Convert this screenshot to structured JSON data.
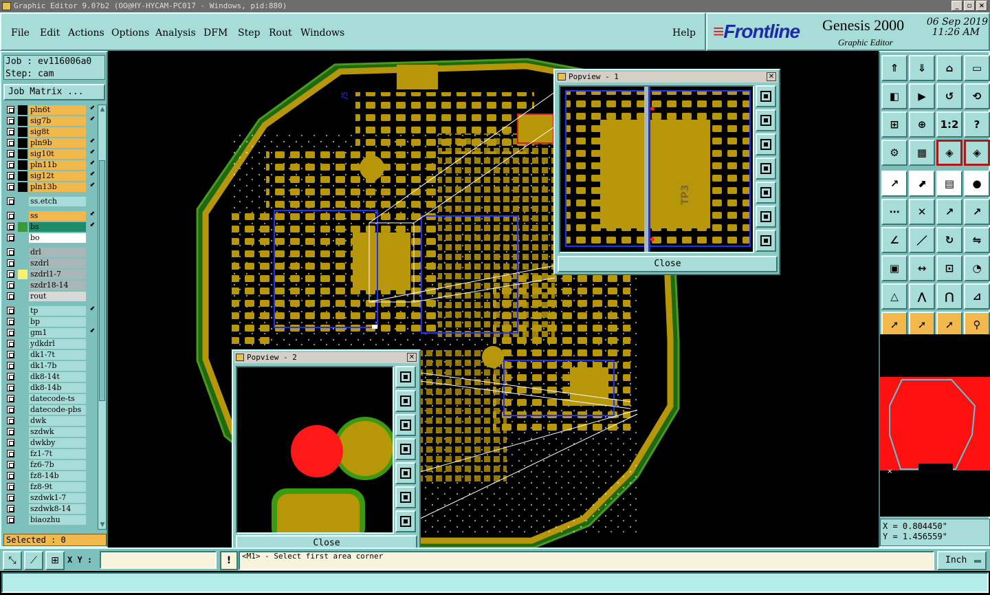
{
  "window": {
    "title": "Graphic Editor 9.0?b2 (OO@HY-HYCAM-PC017 - Windows, pid:880)",
    "buttons": [
      "_",
      "▫",
      "×"
    ]
  },
  "menu": {
    "items": [
      "File",
      "Edit",
      "Actions",
      "Options",
      "Analysis",
      "DFM",
      "Step",
      "Rout",
      "Windows"
    ],
    "help": "Help"
  },
  "brand": {
    "logo": "Frontline",
    "product": "Genesis 2000",
    "subtitle": "Graphic Editor",
    "date": "06 Sep 2019",
    "time": "11:26 AM"
  },
  "job": {
    "job_line": "Job : ev116006a0",
    "step_line": "Step: cam",
    "matrix_button": "Job Matrix ..."
  },
  "layers": [
    {
      "name": "pln6t",
      "color": "#f2b84c",
      "sw": "#000000",
      "mark": "⬋",
      "gap": false
    },
    {
      "name": "sig7b",
      "color": "#f2b84c",
      "sw": "#000000",
      "mark": "⬋",
      "gap": false
    },
    {
      "name": "sig8t",
      "color": "#f2b84c",
      "sw": "#000000",
      "mark": "",
      "gap": false
    },
    {
      "name": "pln9b",
      "color": "#f2b84c",
      "sw": "#000000",
      "mark": "⬋",
      "gap": false
    },
    {
      "name": "sig10t",
      "color": "#f2b84c",
      "sw": "#000000",
      "mark": "⬋",
      "gap": false
    },
    {
      "name": "pln11b",
      "color": "#f2b84c",
      "sw": "#000000",
      "mark": "⬋",
      "gap": false
    },
    {
      "name": "sig12t",
      "color": "#f2b84c",
      "sw": "#000000",
      "mark": "⬋",
      "gap": false
    },
    {
      "name": "pln13b",
      "color": "#f2b84c",
      "sw": "#000000",
      "mark": "⬋",
      "gap": false
    },
    {
      "name": "ss.etch",
      "color": "#a8dcd8",
      "sw": "#7ec0bc",
      "mark": "",
      "gap": true
    },
    {
      "name": "ss",
      "color": "#f2b84c",
      "sw": "#7ec0bc",
      "mark": "⬋",
      "gap": true
    },
    {
      "name": "bs",
      "color": "#1d8a6a",
      "sw": "#3a9a3a",
      "mark": "⬋",
      "gap": false
    },
    {
      "name": "bo",
      "color": "#ffffff",
      "sw": "#7ec0bc",
      "mark": "",
      "gap": false
    },
    {
      "name": "drl",
      "color": "#a8b8b8",
      "sw": "#7ec0bc",
      "mark": "",
      "gap": true
    },
    {
      "name": "szdrl",
      "color": "#a8b8b8",
      "sw": "#7ec0bc",
      "mark": "",
      "gap": false
    },
    {
      "name": "szdrl1-7",
      "color": "#a8b8b8",
      "sw": "#f8f070",
      "mark": "",
      "gap": false
    },
    {
      "name": "szdr18-14",
      "color": "#a8b8b8",
      "sw": "#7ec0bc",
      "mark": "",
      "gap": false
    },
    {
      "name": "rout",
      "color": "#d8d8d8",
      "sw": "#7ec0bc",
      "mark": "",
      "gap": false
    },
    {
      "name": "tp",
      "color": "#a8dcd8",
      "sw": "#7ec0bc",
      "mark": "⬋",
      "gap": true
    },
    {
      "name": "bp",
      "color": "#a8dcd8",
      "sw": "#7ec0bc",
      "mark": "",
      "gap": false
    },
    {
      "name": "gm1",
      "color": "#a8dcd8",
      "sw": "#7ec0bc",
      "mark": "⬋",
      "gap": false
    },
    {
      "name": "ydkdrl",
      "color": "#a8dcd8",
      "sw": "#7ec0bc",
      "mark": "",
      "gap": false
    },
    {
      "name": "dk1-7t",
      "color": "#a8dcd8",
      "sw": "#7ec0bc",
      "mark": "",
      "gap": false
    },
    {
      "name": "dk1-7b",
      "color": "#a8dcd8",
      "sw": "#7ec0bc",
      "mark": "",
      "gap": false
    },
    {
      "name": "dk8-14t",
      "color": "#a8dcd8",
      "sw": "#7ec0bc",
      "mark": "",
      "gap": false
    },
    {
      "name": "dk8-14b",
      "color": "#a8dcd8",
      "sw": "#7ec0bc",
      "mark": "",
      "gap": false
    },
    {
      "name": "datecode-ts",
      "color": "#a8dcd8",
      "sw": "#7ec0bc",
      "mark": "",
      "gap": false
    },
    {
      "name": "datecode-pbs",
      "color": "#a8dcd8",
      "sw": "#7ec0bc",
      "mark": "",
      "gap": false
    },
    {
      "name": "dwk",
      "color": "#a8dcd8",
      "sw": "#7ec0bc",
      "mark": "",
      "gap": false
    },
    {
      "name": "szdwk",
      "color": "#a8dcd8",
      "sw": "#7ec0bc",
      "mark": "",
      "gap": false
    },
    {
      "name": "dwkby",
      "color": "#a8dcd8",
      "sw": "#7ec0bc",
      "mark": "",
      "gap": false
    },
    {
      "name": "fz1-7t",
      "color": "#a8dcd8",
      "sw": "#7ec0bc",
      "mark": "",
      "gap": false
    },
    {
      "name": "fz6-7b",
      "color": "#a8dcd8",
      "sw": "#7ec0bc",
      "mark": "",
      "gap": false
    },
    {
      "name": "fz8-14b",
      "color": "#a8dcd8",
      "sw": "#7ec0bc",
      "mark": "",
      "gap": false
    },
    {
      "name": "fz8-9t",
      "color": "#a8dcd8",
      "sw": "#7ec0bc",
      "mark": "",
      "gap": false
    },
    {
      "name": "szdwk1-7",
      "color": "#a8dcd8",
      "sw": "#7ec0bc",
      "mark": "",
      "gap": false
    },
    {
      "name": "szdwk8-14",
      "color": "#a8dcd8",
      "sw": "#7ec0bc",
      "mark": "",
      "gap": false
    },
    {
      "name": "biaozhu",
      "color": "#a8dcd8",
      "sw": "#7ec0bc",
      "mark": "",
      "gap": false
    }
  ],
  "selected": "Selected : 0",
  "popview1": {
    "title": "Popview - 1",
    "close": "Close",
    "label": "TP3"
  },
  "popview2": {
    "title": "Popview - 2",
    "close": "Close"
  },
  "canvas_labels": {
    "j5": "J5"
  },
  "toolbox": {
    "icons": [
      "step-up-icon",
      "step-down-icon",
      "home-icon",
      "window-icon",
      "pan-left-icon",
      "pan-right-icon",
      "undo-icon",
      "redraw-icon",
      "zoom-fit-icon",
      "zoom-center-icon",
      "zoom-1-2-icon",
      "help-icon",
      "settings-icon",
      "grid-icon",
      "net-select-icon",
      "net-highlight-icon",
      "pad-arrow-icon",
      "line-color-icon",
      "ruler-icon",
      "dot-icon",
      "connect-icon",
      "cross-icon",
      "arrow-red-icon",
      "arrow-blue-icon",
      "angle-icon",
      "slash-icon",
      "rotate-icon",
      "flip-icon",
      "layer-pad-icon",
      "move-icon",
      "frame-icon",
      "overlay-icon",
      "triangle-a-icon",
      "triangle-b-icon",
      "triangle-c-icon",
      "triangle-d-icon",
      "pointer-icon",
      "pointer-box-icon",
      "pointer-select-icon",
      "net-pointer-icon"
    ],
    "glyphs": [
      "⇑",
      "⇓",
      "⌂",
      "▭",
      "◧",
      "▶",
      "↺",
      "⟲",
      "⊞",
      "⊕",
      "1:2",
      "?",
      "⚙",
      "▦",
      "◈",
      "◈",
      "↗",
      "⬈",
      "▤",
      "●",
      "⋯",
      "✕",
      "↗",
      "↗",
      "∠",
      "／",
      "↻",
      "⇋",
      "▣",
      "↔",
      "⊡",
      "◔",
      "△",
      "⋀",
      "⋂",
      "⊿",
      "➚",
      "➚",
      "➚",
      "⚲"
    ]
  },
  "coords": {
    "x": "X = 0.804450\"",
    "y": "Y = 1.456559\""
  },
  "bottom": {
    "xy_label": "X Y :",
    "xy_value": "",
    "alert": "!",
    "status": "<M1> - Select first area corner",
    "units": "Inch"
  }
}
